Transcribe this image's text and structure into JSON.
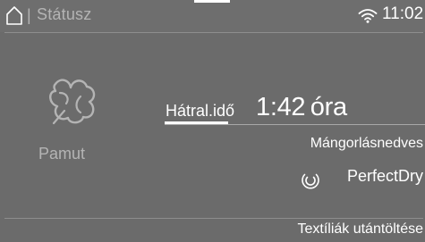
{
  "status_bar": {
    "title": "Státusz",
    "separator": "|",
    "time": "11:02",
    "home_icon": "home-icon",
    "wifi_icon": "wifi-icon"
  },
  "program": {
    "name": "Pamut",
    "icon": "cotton-icon"
  },
  "remaining": {
    "label": "Hátral.idő",
    "value": "1:42",
    "unit": "óra"
  },
  "dry_level": "Mángorlásnedves",
  "perfectdry": {
    "label": "PerfectDry",
    "icon": "perfectdry-icon"
  },
  "footer": {
    "reload_label": "Textíliák utántöltése"
  },
  "colors": {
    "background": "#6b6b6b",
    "text": "#ffffff",
    "muted_text": "#b4b4b4"
  }
}
